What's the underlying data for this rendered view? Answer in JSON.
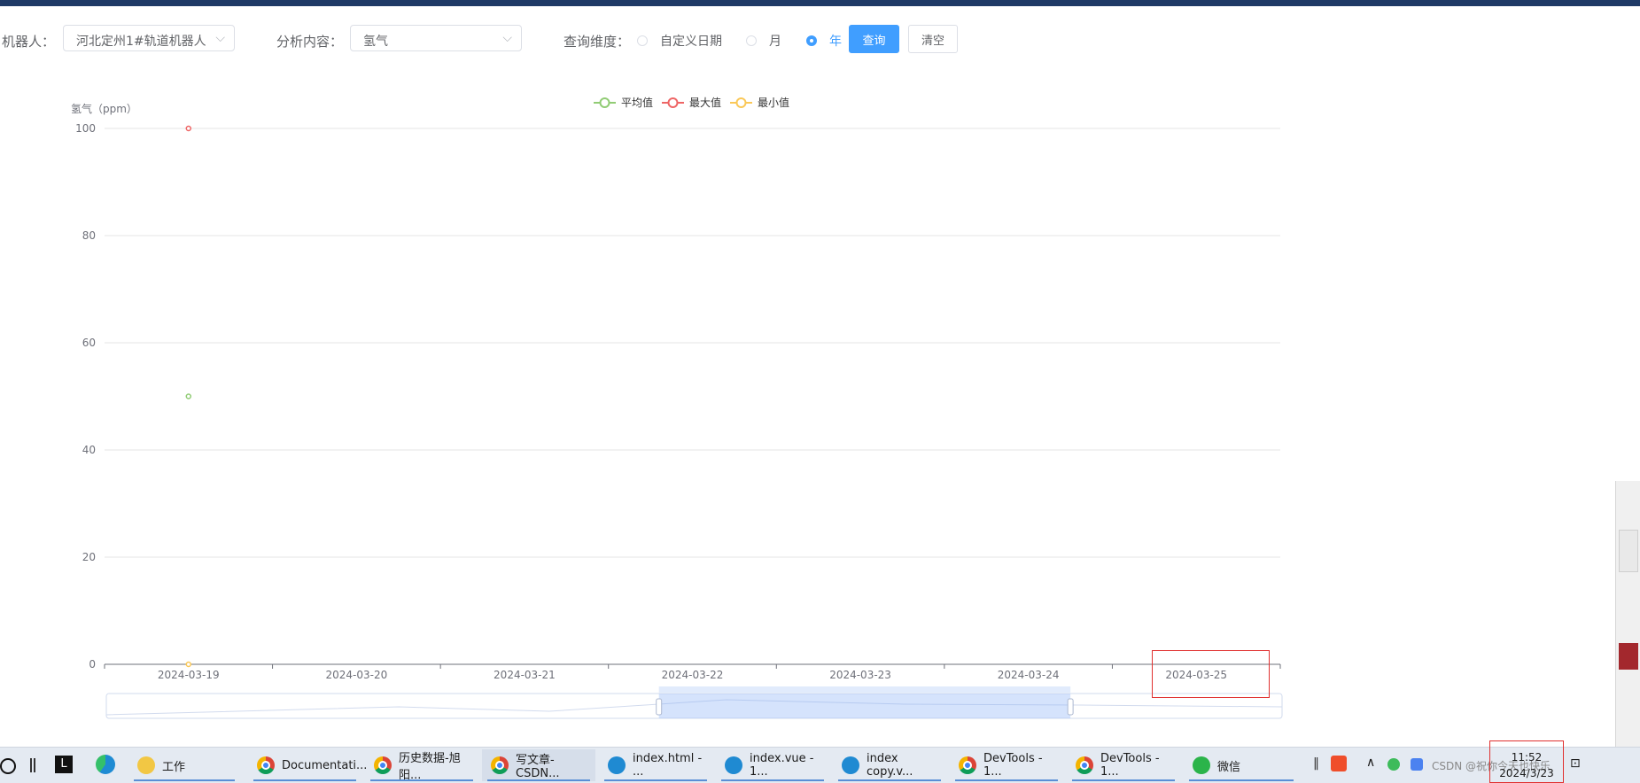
{
  "filters": {
    "robot_label": "机器人：",
    "robot_value": "河北定州1#轨道机器人",
    "analysis_label": "分析内容：",
    "analysis_value": "氢气",
    "dimension_label": "查询维度：",
    "options": [
      "自定义日期",
      "月",
      "年"
    ],
    "selected_option": "年",
    "query_button": "查询",
    "clear_button": "清空"
  },
  "chart_data": {
    "type": "line",
    "ylabel": "氢气（ppm）",
    "ylim": [
      0,
      100
    ],
    "yticks": [
      0,
      20,
      40,
      60,
      80,
      100
    ],
    "categories": [
      "2024-03-19",
      "2024-03-20",
      "2024-03-21",
      "2024-03-22",
      "2024-03-23",
      "2024-03-24",
      "2024-03-25"
    ],
    "series": [
      {
        "name": "平均值",
        "color": "#91cc75",
        "values": [
          50,
          null,
          null,
          null,
          null,
          null,
          null
        ]
      },
      {
        "name": "最大值",
        "color": "#ee6666",
        "values": [
          100,
          null,
          null,
          null,
          null,
          null,
          null
        ]
      },
      {
        "name": "最小值",
        "color": "#fac858",
        "values": [
          0,
          null,
          null,
          null,
          null,
          null,
          null
        ]
      }
    ],
    "legend_position": "top-center",
    "grid": true,
    "datazoom_slider": {
      "start_fraction": 0.47,
      "end_fraction": 0.82
    }
  },
  "taskbar": {
    "items": [
      {
        "label": "工作",
        "icon": "folder-icon"
      },
      {
        "label": "Documentati...",
        "icon": "chrome-icon"
      },
      {
        "label": "历史数据-旭阳...",
        "icon": "chrome-icon"
      },
      {
        "label": "写文章-CSDN...",
        "icon": "chrome-icon"
      },
      {
        "label": "index.html - ...",
        "icon": "vscode-icon"
      },
      {
        "label": "index.vue - 1...",
        "icon": "vscode-icon"
      },
      {
        "label": "index copy.v...",
        "icon": "vscode-icon"
      },
      {
        "label": "DevTools - 1...",
        "icon": "chrome-icon"
      },
      {
        "label": "DevTools - 1...",
        "icon": "chrome-icon"
      },
      {
        "label": "微信",
        "icon": "wechat-icon"
      }
    ],
    "time": "11:52",
    "date": "2024/3/23",
    "watermark": "CSDN @祝你今天也快乐"
  }
}
